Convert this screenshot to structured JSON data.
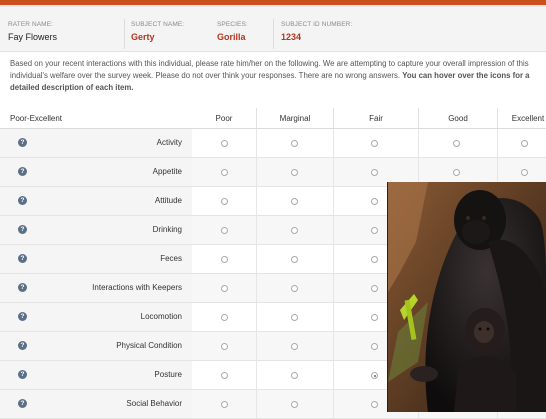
{
  "subject": {
    "rater_label": "RATER NAME:",
    "rater_value": "Fay Flowers",
    "name_label": "SUBJECT NAME:",
    "name_value": "Gerty",
    "species_label": "SPECIES:",
    "species_value": "Gorilla",
    "id_label": "SUBJECT ID NUMBER:",
    "id_value": "1234"
  },
  "intro": {
    "text": "Based on your recent interactions with this individual, please rate him/her on the following. We are attempting to capture your overall impression of this individual's welfare over the survey week. Please do not over think your responses. There are no wrong answers.",
    "bold": "You can hover over the icons for a detailed description of each item."
  },
  "table": {
    "row_header": "Poor-Excellent",
    "columns": [
      "Poor",
      "Marginal",
      "Fair",
      "Good",
      "Excellent"
    ],
    "rows": [
      {
        "label": "Activity",
        "selected": null
      },
      {
        "label": "Appetite",
        "selected": null
      },
      {
        "label": "Attitude",
        "selected": null
      },
      {
        "label": "Drinking",
        "selected": null
      },
      {
        "label": "Feces",
        "selected": null
      },
      {
        "label": "Interactions with Keepers",
        "selected": null
      },
      {
        "label": "Locomotion",
        "selected": null
      },
      {
        "label": "Physical Condition",
        "selected": null
      },
      {
        "label": "Posture",
        "selected": 2
      },
      {
        "label": "Social Behavior",
        "selected": null
      }
    ]
  },
  "colors": {
    "accent": "#c8511e",
    "value_red": "#b3361c",
    "info_icon": "#5b6f86"
  },
  "icons": {
    "info": "info-icon"
  }
}
